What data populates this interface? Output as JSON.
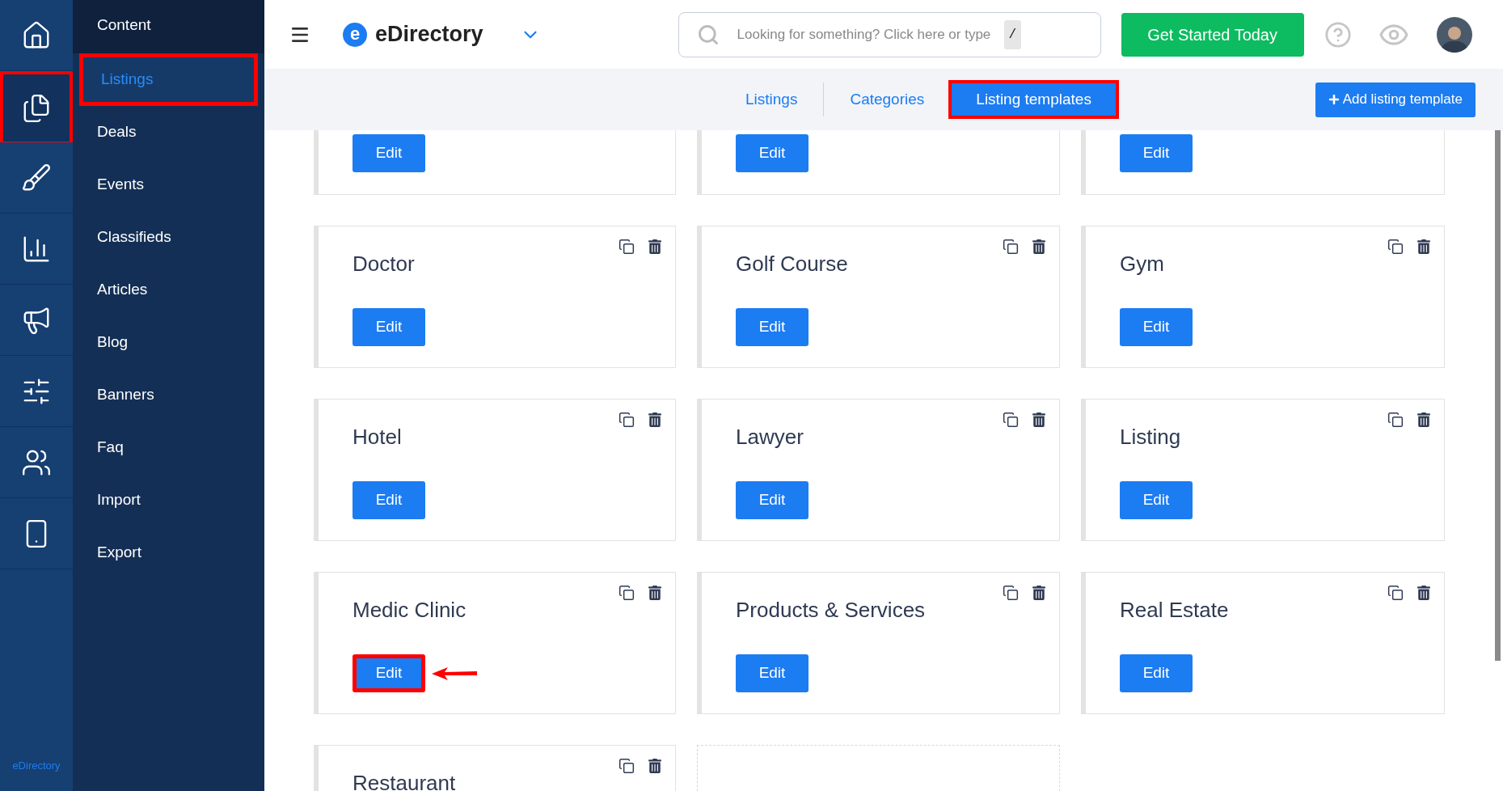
{
  "sidebar_rail": {
    "items": [
      {
        "kind": "home",
        "selected": false,
        "highlighted": false
      },
      {
        "kind": "content",
        "selected": true,
        "highlighted": true
      },
      {
        "kind": "design",
        "selected": false,
        "highlighted": false
      },
      {
        "kind": "reports",
        "selected": false,
        "highlighted": false
      },
      {
        "kind": "promote",
        "selected": false,
        "highlighted": false
      },
      {
        "kind": "settings",
        "selected": false,
        "highlighted": false
      },
      {
        "kind": "users",
        "selected": false,
        "highlighted": false
      },
      {
        "kind": "mobile",
        "selected": false,
        "highlighted": false
      }
    ],
    "footer": "eDirectory"
  },
  "submenu": {
    "title": "Content",
    "items": [
      {
        "label": "Listings",
        "selected": true,
        "highlighted": true
      },
      {
        "label": "Deals",
        "selected": false,
        "highlighted": false
      },
      {
        "label": "Events",
        "selected": false,
        "highlighted": false
      },
      {
        "label": "Classifieds",
        "selected": false,
        "highlighted": false
      },
      {
        "label": "Articles",
        "selected": false,
        "highlighted": false
      },
      {
        "label": "Blog",
        "selected": false,
        "highlighted": false
      },
      {
        "label": "Banners",
        "selected": false,
        "highlighted": false
      },
      {
        "label": "Faq",
        "selected": false,
        "highlighted": false
      },
      {
        "label": "Import",
        "selected": false,
        "highlighted": false
      },
      {
        "label": "Export",
        "selected": false,
        "highlighted": false
      }
    ]
  },
  "header": {
    "brand_mark": "e",
    "brand": "eDirectory",
    "search": {
      "placeholder": "Looking for something? Click here or type",
      "shortcut": "/"
    },
    "cta": "Get Started Today"
  },
  "subnav": {
    "tabs": [
      {
        "label": "Listings",
        "selected": false,
        "highlighted": false
      },
      {
        "label": "Categories",
        "selected": false,
        "highlighted": false
      },
      {
        "label": "Listing templates",
        "selected": true,
        "highlighted": true
      }
    ],
    "add_button": "Add listing template"
  },
  "templates": [
    {
      "kind": "partial",
      "edit": "Edit",
      "highlighted": false
    },
    {
      "kind": "partial",
      "edit": "Edit",
      "highlighted": false
    },
    {
      "kind": "partial",
      "edit": "Edit",
      "highlighted": false
    },
    {
      "kind": "card",
      "name": "Doctor",
      "edit": "Edit",
      "highlighted": false
    },
    {
      "kind": "card",
      "name": "Golf Course",
      "edit": "Edit",
      "highlighted": false
    },
    {
      "kind": "card",
      "name": "Gym",
      "edit": "Edit",
      "highlighted": false
    },
    {
      "kind": "card",
      "name": "Hotel",
      "edit": "Edit",
      "highlighted": false
    },
    {
      "kind": "card",
      "name": "Lawyer",
      "edit": "Edit",
      "highlighted": false
    },
    {
      "kind": "card",
      "name": "Listing",
      "edit": "Edit",
      "highlighted": false
    },
    {
      "kind": "card",
      "name": "Medic Clinic",
      "edit": "Edit",
      "highlighted": true
    },
    {
      "kind": "card",
      "name": "Products & Services",
      "edit": "Edit",
      "highlighted": false
    },
    {
      "kind": "card",
      "name": "Real Estate",
      "edit": "Edit",
      "highlighted": false
    },
    {
      "kind": "card",
      "name": "Restaurant"
    },
    {
      "kind": "empty"
    }
  ]
}
